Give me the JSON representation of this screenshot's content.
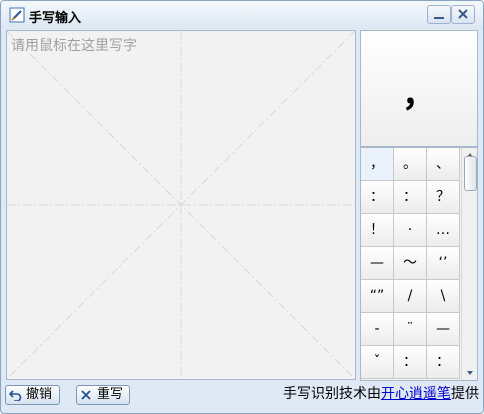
{
  "window": {
    "title": "手写输入",
    "icons": {
      "app": "pencil-pad-icon",
      "minimize": "minimize-icon",
      "close": "close-icon"
    }
  },
  "canvas": {
    "hint": "请用鼠标在这里写字"
  },
  "preview": {
    "char": "，"
  },
  "candidates": [
    "，",
    "。",
    "、",
    "：",
    "：",
    "？",
    "！",
    "·",
    "…",
    "—",
    "～",
    "‘’",
    "“”",
    "/",
    "\\",
    "-",
    "¨",
    "—",
    "ˇ",
    "：",
    "："
  ],
  "buttons": {
    "undo": "撤销",
    "rewrite": "重写"
  },
  "credit": {
    "prefix": "手写识别技术由",
    "link": "开心逍遥笔",
    "suffix": "提供"
  },
  "colors": {
    "accent_link": "#0000cc",
    "window_bg": "#dfe9f5",
    "canvas_bg": "#f2f2f2"
  }
}
